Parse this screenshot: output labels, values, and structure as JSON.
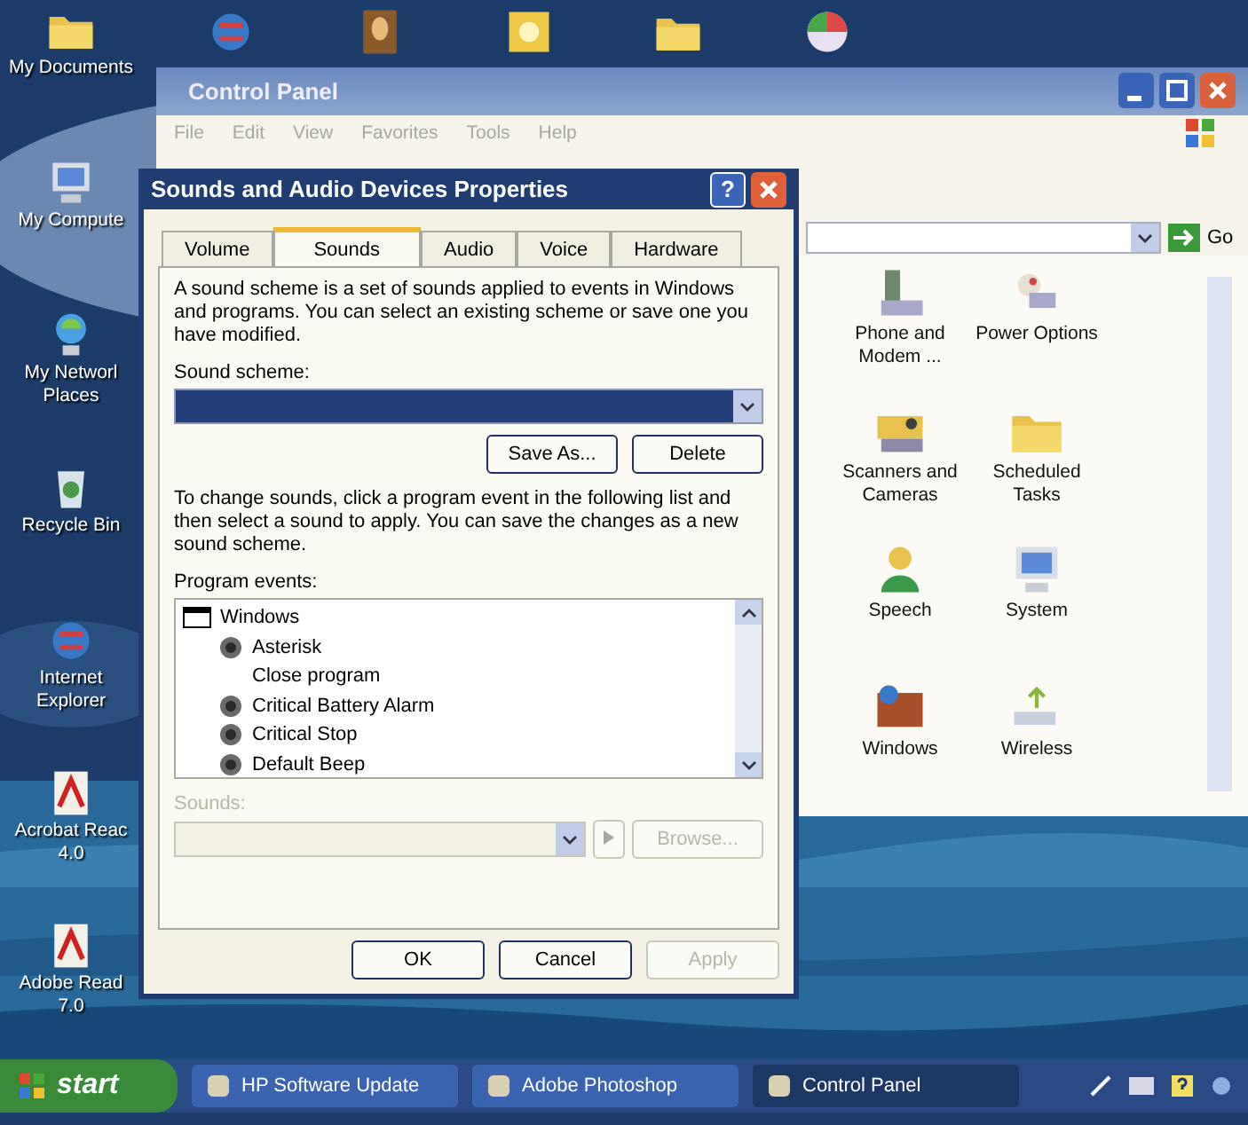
{
  "desktop": {
    "top_icons": [
      {
        "kind": "globe"
      },
      {
        "kind": "portrait"
      },
      {
        "kind": "sun"
      },
      {
        "kind": "folder"
      },
      {
        "kind": "disc"
      }
    ],
    "icons": [
      {
        "kind": "folder",
        "lines": [
          "My Documents"
        ]
      },
      {
        "kind": "computer",
        "lines": [
          "My Compute"
        ]
      },
      {
        "kind": "network",
        "lines": [
          "My Networl",
          "Places"
        ]
      },
      {
        "kind": "recycle",
        "lines": [
          "Recycle Bin"
        ]
      },
      {
        "kind": "globe",
        "lines": [
          "Internet",
          "Explorer"
        ]
      },
      {
        "kind": "pdf",
        "lines": [
          "Acrobat Reac",
          "4.0"
        ]
      },
      {
        "kind": "pdf",
        "lines": [
          "Adobe Read",
          "7.0"
        ]
      }
    ]
  },
  "control_panel": {
    "title": "Control Panel",
    "menu": [
      "File",
      "Edit",
      "View",
      "Favorites",
      "Tools",
      "Help"
    ],
    "go_button": "Go",
    "items": [
      {
        "kind": "phone",
        "lines": [
          "Phone and",
          "Modem ..."
        ]
      },
      {
        "kind": "plug",
        "lines": [
          "Power Options"
        ]
      },
      {
        "kind": "camera",
        "lines": [
          "Scanners and",
          "Cameras"
        ]
      },
      {
        "kind": "folder",
        "lines": [
          "Scheduled",
          "Tasks"
        ]
      },
      {
        "kind": "person",
        "lines": [
          "Speech"
        ]
      },
      {
        "kind": "computer",
        "lines": [
          "System"
        ]
      },
      {
        "kind": "wall",
        "lines": [
          "Windows"
        ]
      },
      {
        "kind": "antenna",
        "lines": [
          "Wireless"
        ]
      }
    ]
  },
  "dialog": {
    "title": "Sounds and Audio Devices Properties",
    "help_button": "?",
    "tabs": [
      {
        "label": "Volume",
        "selected": false
      },
      {
        "label": "Sounds",
        "selected": true
      },
      {
        "label": "Audio",
        "selected": false
      },
      {
        "label": "Voice",
        "selected": false
      },
      {
        "label": "Hardware",
        "selected": false
      }
    ],
    "intro": "A sound scheme is a set of sounds applied to events in Windows and programs. You can select an existing scheme or save one you have modified.",
    "scheme_label": "Sound scheme:",
    "scheme_buttons": [
      {
        "label": "Save As...",
        "disabled": false
      },
      {
        "label": "Delete",
        "disabled": false
      }
    ],
    "instructions": "To change sounds, click a program event in the following list and then select a sound to apply. You can save the changes as a new sound scheme.",
    "events_label": "Program events:",
    "events": [
      {
        "label": "Windows",
        "children": [
          {
            "label": "Asterisk",
            "sound": true
          },
          {
            "label": "Close program",
            "sound": false
          },
          {
            "label": "Critical Battery Alarm",
            "sound": true
          },
          {
            "label": "Critical Stop",
            "sound": true
          },
          {
            "label": "Default Beep",
            "sound": true
          }
        ]
      }
    ],
    "sounds_label": {
      "text": "Sounds:",
      "disabled": true
    },
    "sounds_field": {
      "disabled": true
    },
    "play_button": {
      "disabled": true
    },
    "browse_button": {
      "label": "Browse...",
      "disabled": true
    },
    "buttons": [
      {
        "label": "OK",
        "disabled": false
      },
      {
        "label": "Cancel",
        "disabled": false
      },
      {
        "label": "Apply",
        "disabled": true
      }
    ]
  },
  "taskbar": {
    "start": "start",
    "tasks": [
      {
        "label": "HP Software Update",
        "selected": false
      },
      {
        "label": "Adobe Photoshop",
        "selected": false
      },
      {
        "label": "Control Panel",
        "selected": true
      }
    ]
  }
}
